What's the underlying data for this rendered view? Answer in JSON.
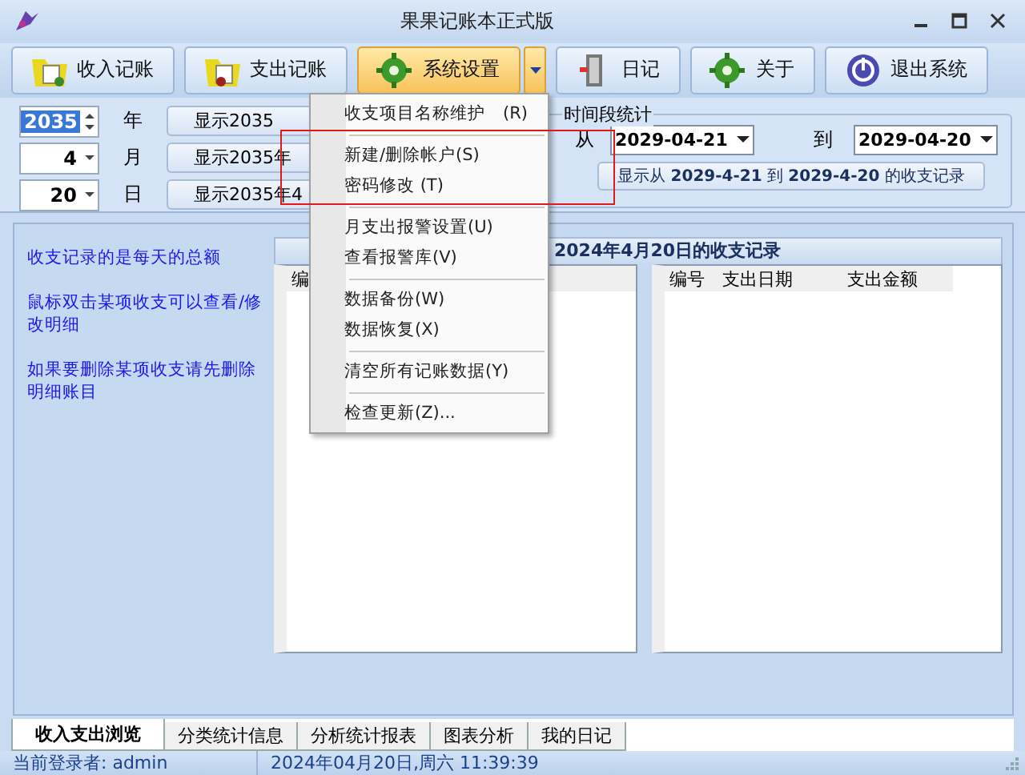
{
  "window": {
    "title": "果果记账本正式版"
  },
  "toolbar": [
    {
      "label": "收入记账",
      "selected": false,
      "dropdown": false
    },
    {
      "label": "支出记账",
      "selected": false,
      "dropdown": false
    },
    {
      "label": "系统设置",
      "selected": true,
      "dropdown": true
    },
    {
      "label": "日记",
      "selected": false,
      "dropdown": false
    },
    {
      "label": "关于",
      "selected": false,
      "dropdown": false
    },
    {
      "label": "退出系统",
      "selected": false,
      "dropdown": false
    }
  ],
  "date_rows": [
    {
      "value": "2035",
      "selected": true,
      "kind": "spin",
      "unit": "年",
      "button": "显示2035"
    },
    {
      "value": "4",
      "selected": false,
      "kind": "combo",
      "unit": "月",
      "button": "显示2035年"
    },
    {
      "value": "20",
      "selected": false,
      "kind": "combo",
      "unit": "日",
      "button": "显示2035年4"
    }
  ],
  "range": {
    "legend": "时间段统计",
    "from_label": "从",
    "from": "2029-04-21",
    "to_label": "到",
    "to": "2029-04-20",
    "button": "显示从 **2029-4-21** 到 **2029-4-20** 的收支记录"
  },
  "tips": [
    "收支记录的是每天的总额",
    "鼠标双击某项收支可以查看/修改明细",
    "如果要删除某项收支请先删除明细账目"
  ],
  "records_header": "2024年4月20日的收支记录",
  "left_table": {
    "columns": [
      "编"
    ]
  },
  "right_table": {
    "columns": [
      "编号",
      "支出日期",
      "支出金额"
    ]
  },
  "tabs": [
    {
      "label": "收入支出浏览",
      "selected": true
    },
    {
      "label": "分类统计信息",
      "selected": false
    },
    {
      "label": "分析统计报表",
      "selected": false
    },
    {
      "label": "图表分析",
      "selected": false
    },
    {
      "label": "我的日记",
      "selected": false
    }
  ],
  "status_bar": [
    "当前登录者: admin",
    "2024年04月20日,周六 11:39:39"
  ],
  "menu": [
    {
      "kind": "item",
      "label": "收支项目名称维护　(R)"
    },
    {
      "kind": "separator"
    },
    {
      "kind": "item",
      "label": "新建/删除帐户(S)"
    },
    {
      "kind": "item",
      "label": "密码修改 (T)"
    },
    {
      "kind": "separator"
    },
    {
      "kind": "item",
      "label": "月支出报警设置(U)"
    },
    {
      "kind": "item",
      "label": "查看报警库(V)"
    },
    {
      "kind": "separator"
    },
    {
      "kind": "item",
      "label": "数据备份(W)"
    },
    {
      "kind": "item",
      "label": "数据恢复(X)"
    },
    {
      "kind": "separator"
    },
    {
      "kind": "item",
      "label": "清空所有记账数据(Y)"
    },
    {
      "kind": "separator"
    },
    {
      "kind": "item",
      "label": "检查更新(Z)..."
    }
  ]
}
